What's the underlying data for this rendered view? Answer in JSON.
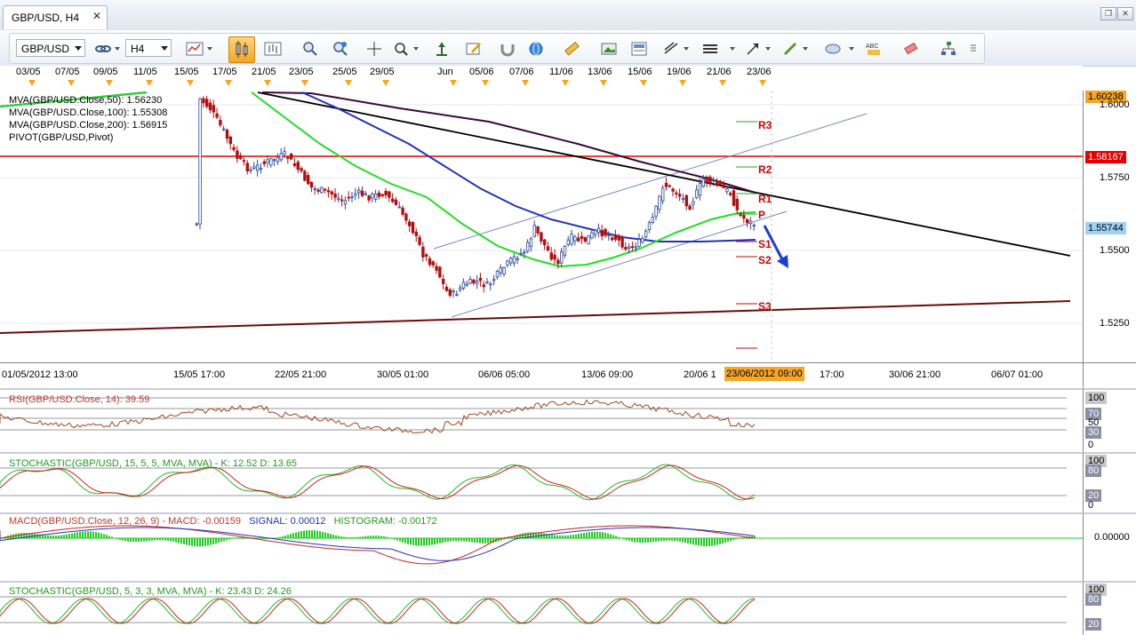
{
  "window": {
    "tab_title": "GBP/USD, H4",
    "tab_close": "✕",
    "restore_btn": "❐",
    "close_btn": "✕"
  },
  "toolbar": {
    "symbol": "GBP/USD",
    "timeframe": "H4",
    "icons": [
      "link-icon",
      "chart-type-icon",
      "candlestick-icon",
      "bar-chart-icon",
      "zoom-in-icon",
      "zoom-out-icon",
      "crosshair-icon",
      "magnify-icon",
      "auto-scroll-icon",
      "edit-icon",
      "magnet-icon",
      "globe-icon",
      "ruler-icon",
      "image-icon",
      "template-icon",
      "trendline-tool-icon",
      "horizontal-line-icon",
      "pencil-icon",
      "ellipse-icon",
      "text-label-icon",
      "eraser-icon",
      "object-tree-icon"
    ]
  },
  "top_dates": [
    "03/05",
    "07/05",
    "09/05",
    "11/05",
    "15/05",
    "17/05",
    "21/05",
    "23/05",
    "25/05",
    "29/05",
    "Jun",
    "05/06",
    "07/06",
    "11/06",
    "13/06",
    "15/06",
    "19/06",
    "21/06",
    "23/06"
  ],
  "bottom_dates": [
    "01/05/2012 13:00",
    "15/05 17:00",
    "22/05 21:00",
    "30/05 01:00",
    "06/06 05:00",
    "13/06 09:00",
    "20/06 1",
    "17:00",
    "30/06 21:00",
    "06/07 01:00"
  ],
  "cursor_time": "23/06/2012 09:00",
  "main": {
    "legend": [
      {
        "text": "MVA(GBP/USD.Close,50): 1.56230",
        "color": "#22cc22"
      },
      {
        "text": "MVA(GBP/USD.Close,100): 1.55308",
        "color": "#2222aa"
      },
      {
        "text": "MVA(GBP/USD.Close,200): 1.56915",
        "color": "#333333"
      },
      {
        "text": "PIVOT(GBP/USD,Pivot)",
        "color": "#000000"
      }
    ],
    "y_ticks": [
      "1.6000",
      "1.5750",
      "1.5500",
      "1.5250"
    ],
    "y_top_label": "1.60238",
    "y_red_label": "1.58167",
    "y_price_label": "1.55744",
    "pivot_labels": [
      "R3",
      "R2",
      "R1",
      "P",
      "S1",
      "S2",
      "S3"
    ],
    "colors": {
      "ma50": "#22dd22",
      "ma100": "#2233bb",
      "ma200": "#3a0a3a",
      "resistance": "#e60000",
      "support": "#6b0a0a",
      "trend": "#000000",
      "channel": "#7a86c8",
      "arrow": "#1a3fd6",
      "bull": "#2a4a9a",
      "bear": "#b01010"
    }
  },
  "rsi": {
    "header": "RSI(GBP/USD.Close, 14): 39.59",
    "ticks": [
      "100",
      "70",
      "50",
      "30",
      "0"
    ]
  },
  "stoch1": {
    "header": "STOCHASTIC(GBP/USD, 15, 5, 5, MVA, MVA) -   K: 12.52   D: 13.65",
    "ticks": [
      "100",
      "80",
      "20",
      "0"
    ]
  },
  "macd": {
    "header_name": "MACD(GBP/USD.Close, 12, 26, 9) -  MACD: -0.00159",
    "header_signal": "SIGNAL: 0.00012",
    "header_hist": "HISTOGRAM: -0.00172",
    "tick": "0.00000"
  },
  "stoch2": {
    "header": "STOCHASTIC(GBP/USD, 5, 3, 3, MVA, MVA) -   K: 23.43   D: 24.26",
    "ticks": [
      "100",
      "80",
      "20"
    ]
  }
}
